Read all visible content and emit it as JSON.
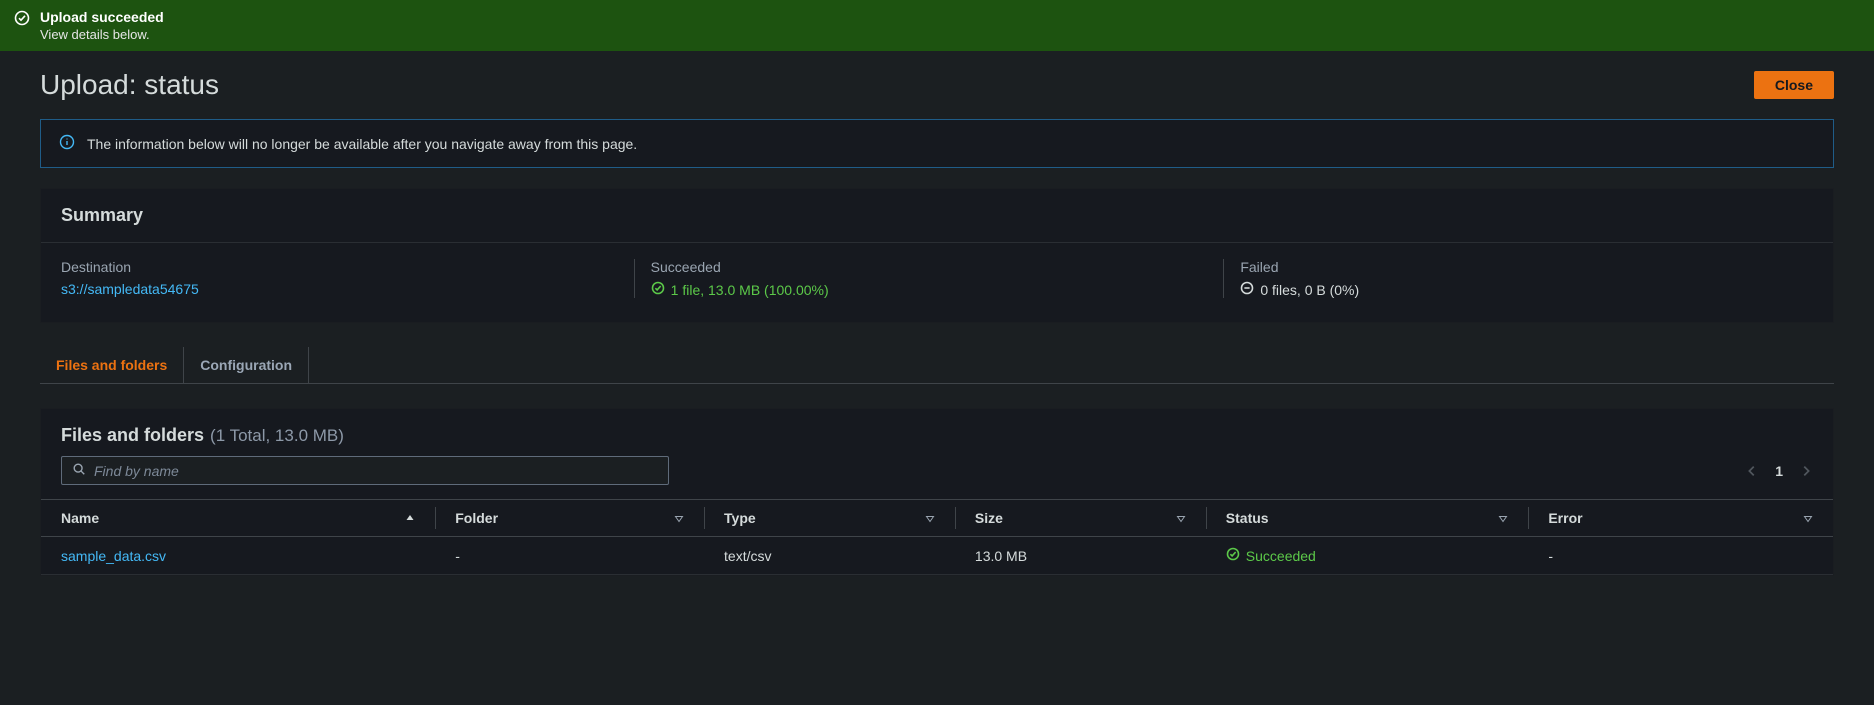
{
  "banner": {
    "title": "Upload succeeded",
    "sub": "View details below."
  },
  "page": {
    "title": "Upload: status",
    "close_label": "Close"
  },
  "info": {
    "message": "The information below will no longer be available after you navigate away from this page."
  },
  "summary": {
    "title": "Summary",
    "destination": {
      "label": "Destination",
      "value": "s3://sampledata54675"
    },
    "succeeded": {
      "label": "Succeeded",
      "value": "1 file, 13.0 MB (100.00%)"
    },
    "failed": {
      "label": "Failed",
      "value": "0 files, 0 B (0%)"
    }
  },
  "tabs": {
    "files": "Files and folders",
    "config": "Configuration"
  },
  "files": {
    "title": "Files and folders",
    "count_suffix": "(1 Total, 13.0 MB)",
    "search_placeholder": "Find by name",
    "page_number": "1",
    "columns": {
      "name": "Name",
      "folder": "Folder",
      "type": "Type",
      "size": "Size",
      "status": "Status",
      "error": "Error"
    },
    "rows": [
      {
        "name": "sample_data.csv",
        "folder": "-",
        "type": "text/csv",
        "size": "13.0 MB",
        "status": "Succeeded",
        "error": "-"
      }
    ]
  }
}
